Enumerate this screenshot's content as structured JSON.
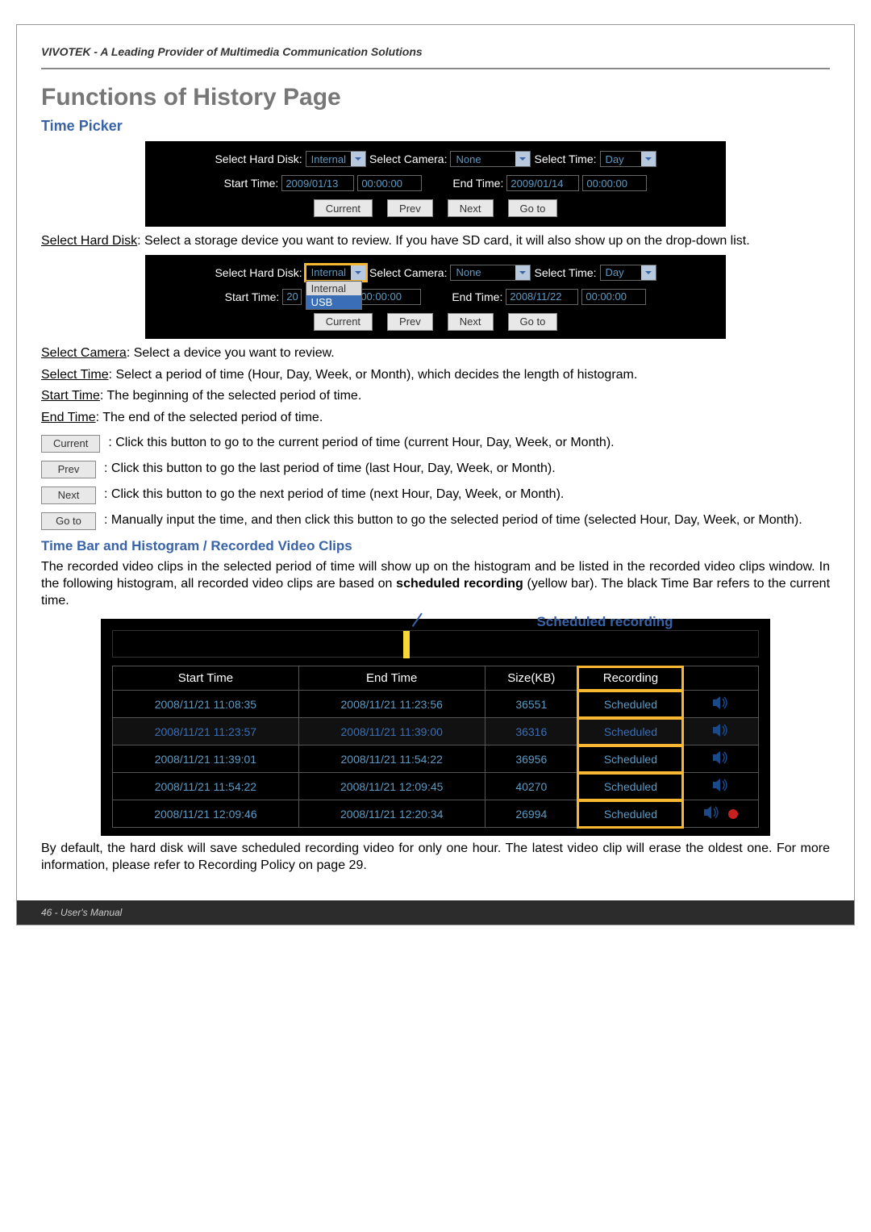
{
  "header": "VIVOTEK - A Leading Provider of Multimedia Communication Solutions",
  "h1": "Functions of History Page",
  "h2_timepicker": "Time Picker",
  "panel1": {
    "hd_label": "Select Hard Disk:",
    "hd_value": "Internal",
    "cam_label": "Select Camera:",
    "cam_value": "None",
    "time_label": "Select Time:",
    "time_value": "Day",
    "start_label": "Start Time:",
    "start_date": "2009/01/13",
    "start_time": "00:00:00",
    "end_label": "End Time:",
    "end_date": "2009/01/14",
    "end_time": "00:00:00",
    "btn_current": "Current",
    "btn_prev": "Prev",
    "btn_next": "Next",
    "btn_goto": "Go to"
  },
  "desc_hd": "Select a storage device you want to review. If you have SD card, it will also show up on the drop-down list.",
  "desc_hd_label": "Select Hard Disk",
  "panel2": {
    "hd_value": "Internal",
    "hd_opts": {
      "a": "Internal",
      "b": "USB"
    },
    "start_date_partial": "20",
    "start_time": "00:00:00",
    "end_date": "2008/11/22",
    "end_time": "00:00:00",
    "cam_value": "None",
    "time_value": "Day"
  },
  "desc_cam_label": "Select Camera",
  "desc_cam": "Select a device you want to review.",
  "desc_time_label": "Select Time",
  "desc_time": "Select a period of time (Hour, Day, Week, or Month), which decides the length of histogram.",
  "desc_start_label": "Start Time",
  "desc_start": "The beginning of the selected period of time.",
  "desc_end_label": "End Time",
  "desc_end": "The end of the selected period of time.",
  "btn_defs": {
    "current": "Current",
    "current_txt": ": Click this button to go to the current period of time (current Hour, Day, Week, or Month).",
    "prev": "Prev",
    "prev_txt": ": Click this button to go the last period of time (last Hour, Day, Week, or Month).",
    "next": "Next",
    "next_txt": ": Click this button to go the next period of time (next Hour, Day, Week, or Month).",
    "goto": "Go to",
    "goto_txt": ": Manually input the time, and then click this button to go the selected period of time (selected Hour, Day, Week, or Month)."
  },
  "h3_hist": "Time Bar and Histogram / Recorded Video Clips",
  "hist_intro": "The recorded video clips in the selected period of time will show up on the histogram and be listed in the recorded video clips window. In the following histogram, all recorded video clips are based on ",
  "hist_intro_bold": "scheduled recording",
  "hist_intro2": " (yellow bar). The black Time Bar refers to the current time.",
  "annot_sched": "Scheduled recording",
  "table": {
    "h_start": "Start Time",
    "h_end": "End Time",
    "h_size": "Size(KB)",
    "h_rec": "Recording",
    "rows": [
      {
        "s": "2008/11/21 11:08:35",
        "e": "2008/11/21 11:23:56",
        "sz": "36551",
        "r": "Scheduled"
      },
      {
        "s": "2008/11/21 11:23:57",
        "e": "2008/11/21 11:39:00",
        "sz": "36316",
        "r": "Scheduled"
      },
      {
        "s": "2008/11/21 11:39:01",
        "e": "2008/11/21 11:54:22",
        "sz": "36956",
        "r": "Scheduled"
      },
      {
        "s": "2008/11/21 11:54:22",
        "e": "2008/11/21 12:09:45",
        "sz": "40270",
        "r": "Scheduled"
      },
      {
        "s": "2008/11/21 12:09:46",
        "e": "2008/11/21 12:20:34",
        "sz": "26994",
        "r": "Scheduled"
      }
    ]
  },
  "hist_outro": "By default, the hard disk will save scheduled recording video for only one hour. The latest video clip will erase the oldest one. For more information, please refer to Recording Policy on page 29.",
  "footer": "46 - User's Manual"
}
